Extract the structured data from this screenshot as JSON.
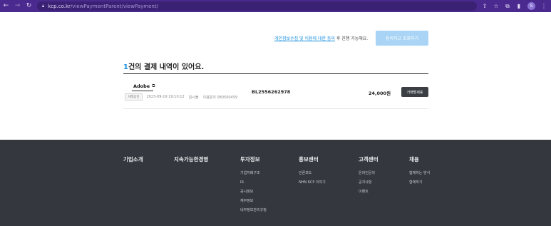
{
  "browser": {
    "url_host": "kcp.co.kr",
    "url_path": "/viewPaymentParent/viewPayment/",
    "profile_initial": "S"
  },
  "consent": {
    "link_privacy": "개인정보수집 및 이용",
    "link_and": "에 대한 동의",
    "suffix": " 후 진행 가능해요.",
    "button_label": "동의하고 조회하기"
  },
  "result": {
    "count": "1",
    "heading_rest": "건의 결제 내역이 있어요."
  },
  "transaction": {
    "merchant": "Adobe",
    "status_tag": "거래승인",
    "datetime": "2023-09-19 19:10:12",
    "method": "일시불",
    "inquiry_no": "이용문의 080500459",
    "order_no": "BL2556262978",
    "amount": "24,000원",
    "receipt_button": "거래명세표"
  },
  "footer": {
    "columns": [
      {
        "title": "기업소개",
        "items": []
      },
      {
        "title": "지속가능한경영",
        "items": []
      },
      {
        "title": "투자정보",
        "items": [
          "기업지배구조",
          "IR",
          "공시정보",
          "재무정보",
          "내부정보관리규정"
        ]
      },
      {
        "title": "홍보센터",
        "items": [
          "언론보도",
          "NHN KCP 이야기"
        ]
      },
      {
        "title": "고객센터",
        "items": [
          "온라인문의",
          "공지사항",
          "이벤트"
        ]
      },
      {
        "title": "채용",
        "items": [
          "함께하는 방식",
          "함께하기"
        ]
      }
    ]
  },
  "colors": {
    "browser_bar": "#4a2a8f",
    "accent_blue": "#1a8fe0",
    "consent_button": "#a9d4f5",
    "receipt_button": "#3b3f44",
    "footer_bg": "#34373d"
  }
}
